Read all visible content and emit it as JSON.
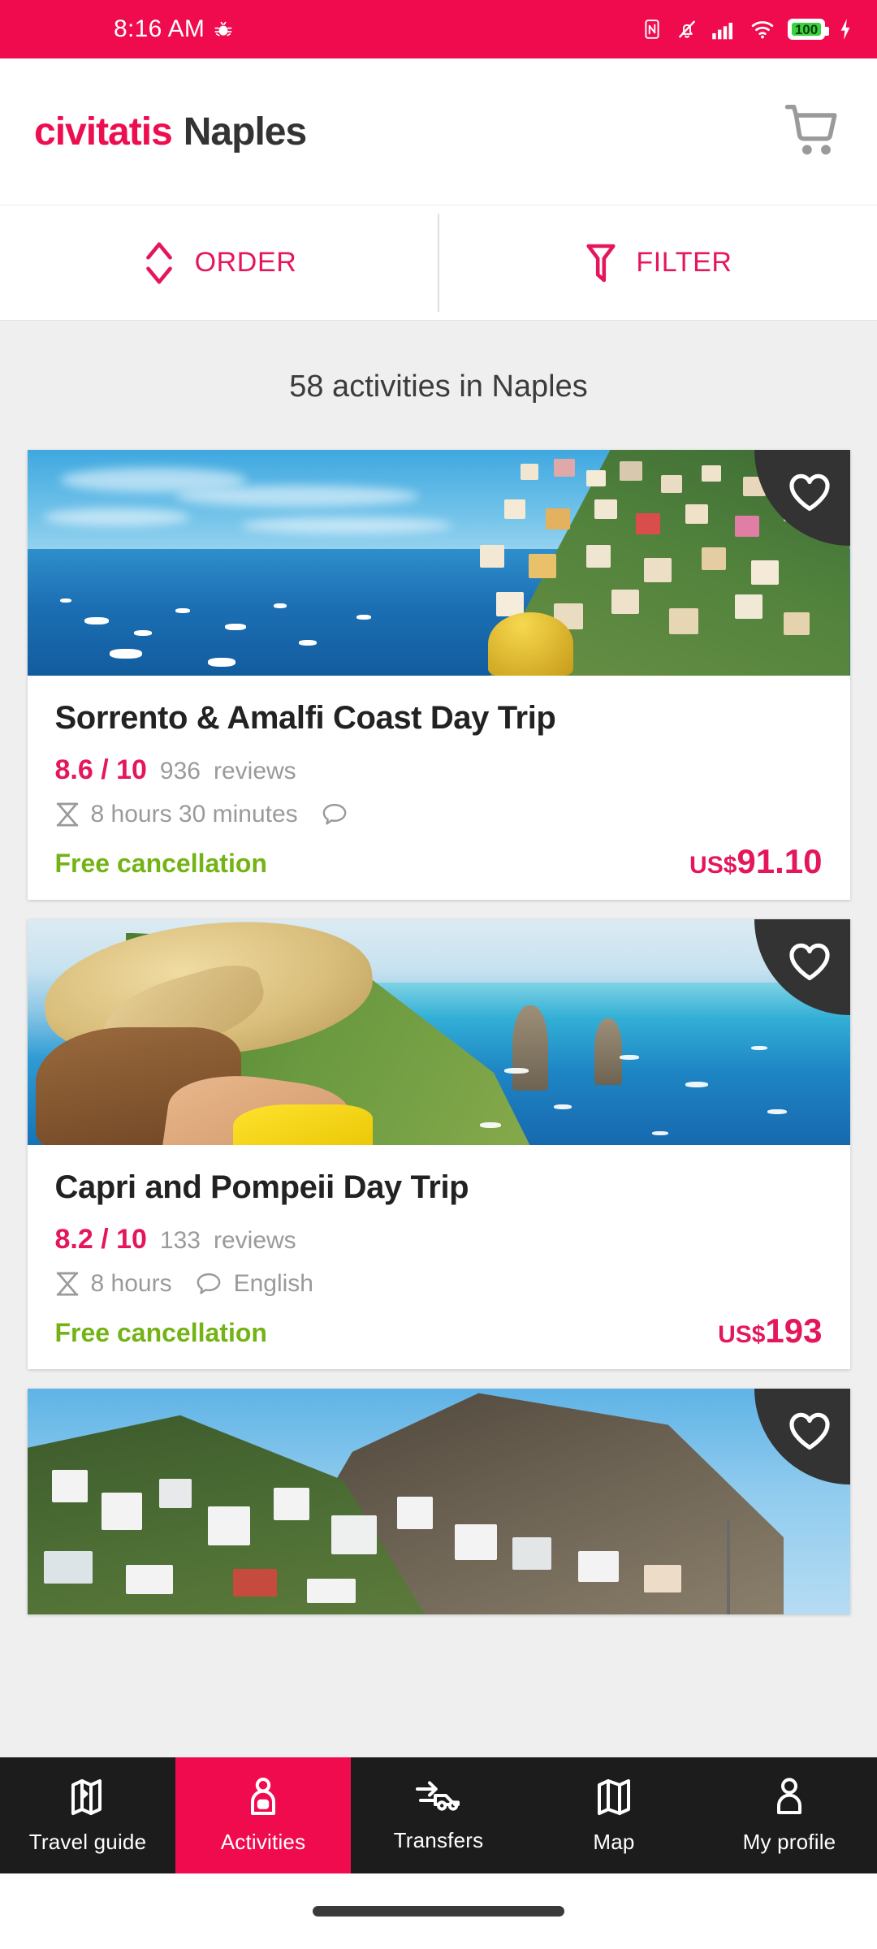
{
  "status_bar": {
    "time": "8:16 AM",
    "battery_percent": "100",
    "icons": [
      "bug-icon",
      "nfc-icon",
      "mute-bell-icon",
      "signal-bars-icon",
      "wifi-icon",
      "battery-icon",
      "charging-bolt-icon"
    ]
  },
  "header": {
    "brand": "civitatis",
    "city": "Naples",
    "cart_icon": "shopping-cart-icon"
  },
  "toolbar": {
    "order_label": "ORDER",
    "order_icon": "sort-updown-icon",
    "filter_label": "FILTER",
    "filter_icon": "funnel-icon"
  },
  "results": {
    "title": "58 activities in Naples"
  },
  "colors": {
    "accent_pink": "#E5175B",
    "status_bar": "#F00B4E",
    "brand_pink": "#ED0E50",
    "green": "#74B316",
    "dark_nav": "#1c1c1c",
    "page_bg": "#efefef"
  },
  "activities": [
    {
      "title": "Sorrento & Amalfi Coast Day Trip",
      "rating": "8.6 / 10",
      "reviews_count": "936",
      "reviews_label": "reviews",
      "duration": "8 hours 30 minutes",
      "language": "",
      "free_cancellation": "Free cancellation",
      "price_currency": "US$",
      "price_amount": "91.10",
      "favorite_icon": "heart-outline-icon",
      "duration_icon": "hourglass-icon",
      "language_icon": "speech-bubble-icon",
      "image_alt": "Amalfi coast cliffside town over blue sea"
    },
    {
      "title": "Capri and Pompeii Day Trip",
      "rating": "8.2 / 10",
      "reviews_count": "133",
      "reviews_label": "reviews",
      "duration": "8 hours",
      "language": "English",
      "free_cancellation": "Free cancellation",
      "price_currency": "US$",
      "price_amount": "193",
      "favorite_icon": "heart-outline-icon",
      "duration_icon": "hourglass-icon",
      "language_icon": "speech-bubble-icon",
      "image_alt": "Woman in straw hat looking at Capri Faraglioni rocks"
    },
    {
      "title": "",
      "rating": "",
      "reviews_count": "",
      "reviews_label": "",
      "duration": "",
      "language": "",
      "free_cancellation": "",
      "price_currency": "",
      "price_amount": "",
      "favorite_icon": "heart-outline-icon",
      "duration_icon": "",
      "language_icon": "",
      "image_alt": "White coastal town beneath a mountain cliff"
    }
  ],
  "bottom_nav": {
    "items": [
      {
        "label": "Travel guide",
        "icon": "guidebook-map-icon",
        "active": false
      },
      {
        "label": "Activities",
        "icon": "activity-person-icon",
        "active": true
      },
      {
        "label": "Transfers",
        "icon": "transfer-car-arrow-icon",
        "active": false
      },
      {
        "label": "Map",
        "icon": "folded-map-icon",
        "active": false
      },
      {
        "label": "My profile",
        "icon": "user-profile-icon",
        "active": false
      }
    ]
  }
}
